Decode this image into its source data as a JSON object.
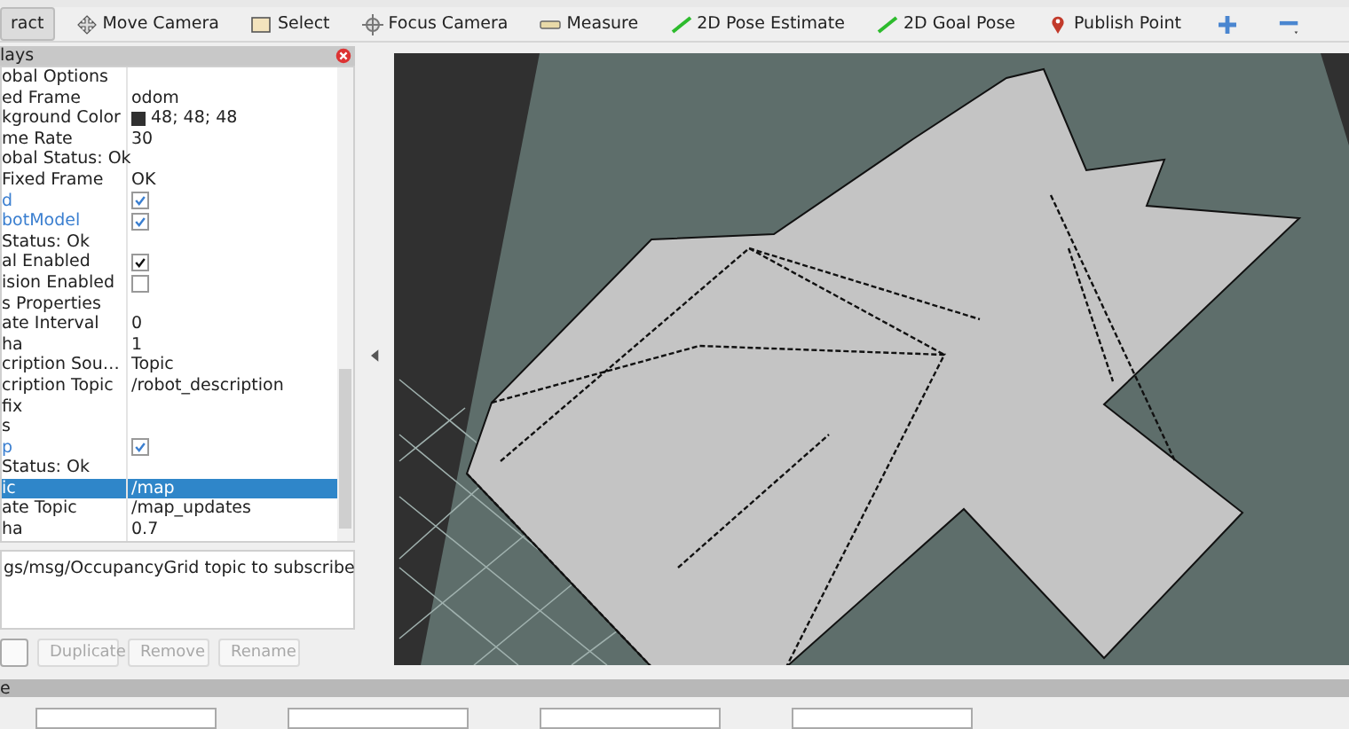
{
  "toolbar": {
    "tools": [
      {
        "label": "ract",
        "selected": true
      },
      {
        "label": "Move Camera",
        "selected": false
      },
      {
        "label": "Select",
        "selected": false
      },
      {
        "label": "Focus Camera",
        "selected": false
      },
      {
        "label": "Measure",
        "selected": false
      },
      {
        "label": "2D Pose Estimate",
        "selected": false
      },
      {
        "label": "2D Goal Pose",
        "selected": false
      },
      {
        "label": "Publish Point",
        "selected": false
      }
    ]
  },
  "displays": {
    "title": "lays",
    "rows": [
      {
        "kind": "text",
        "label": "obal Options",
        "group": false,
        "selected": false
      },
      {
        "kind": "text",
        "label": "ed Frame",
        "value": "odom",
        "group": false,
        "selected": false
      },
      {
        "kind": "color",
        "label": "kground Color",
        "value": "48; 48; 48",
        "color": "#303030",
        "group": false,
        "selected": false
      },
      {
        "kind": "text",
        "label": "me Rate",
        "value": "30",
        "group": false,
        "selected": false
      },
      {
        "kind": "text",
        "label": "obal Status: Ok",
        "group": false,
        "selected": false
      },
      {
        "kind": "text",
        "label": "Fixed Frame",
        "value": "OK",
        "group": false,
        "selected": false
      },
      {
        "kind": "check",
        "label": "d",
        "checked": true,
        "group": true,
        "selected": false
      },
      {
        "kind": "check",
        "label": "botModel",
        "checked": true,
        "group": true,
        "selected": false
      },
      {
        "kind": "text",
        "label": "Status: Ok",
        "group": false,
        "selected": false
      },
      {
        "kind": "check",
        "label": "al Enabled",
        "checked": true,
        "group": false,
        "selected": false
      },
      {
        "kind": "check",
        "label": "ision Enabled",
        "checked": false,
        "group": false,
        "selected": false
      },
      {
        "kind": "text",
        "label": "s Properties",
        "group": false,
        "selected": false
      },
      {
        "kind": "text",
        "label": "ate Interval",
        "value": "0",
        "group": false,
        "selected": false
      },
      {
        "kind": "text",
        "label": "ha",
        "value": "1",
        "group": false,
        "selected": false
      },
      {
        "kind": "text",
        "label": "cription Sou…",
        "value": "Topic",
        "group": false,
        "selected": false
      },
      {
        "kind": "text",
        "label": "cription Topic",
        "value": "/robot_description",
        "group": false,
        "selected": false
      },
      {
        "kind": "text",
        "label": "fix",
        "group": false,
        "selected": false
      },
      {
        "kind": "text",
        "label": "s",
        "group": false,
        "selected": false
      },
      {
        "kind": "check",
        "label": "p",
        "checked": true,
        "group": true,
        "selected": false
      },
      {
        "kind": "text",
        "label": "Status: Ok",
        "group": false,
        "selected": false
      },
      {
        "kind": "text",
        "label": "ic",
        "value": "/map",
        "group": false,
        "selected": true
      },
      {
        "kind": "text",
        "label": "ate Topic",
        "value": "/map_updates",
        "group": false,
        "selected": false
      },
      {
        "kind": "text",
        "label": "ha",
        "value": "0.7",
        "group": false,
        "selected": false
      }
    ],
    "description": "gs/msg/OccupancyGrid topic to subscribe",
    "buttons": [
      {
        "disabled": false
      },
      {
        "label": "Duplicate",
        "disabled": true
      },
      {
        "label": "Remove",
        "disabled": true
      },
      {
        "label": "Rename",
        "disabled": true
      }
    ]
  },
  "time_panel": {
    "title": "e"
  }
}
